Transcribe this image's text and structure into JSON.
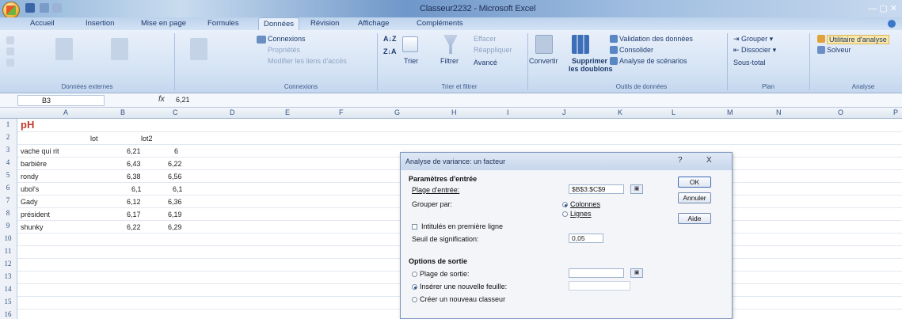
{
  "window": {
    "title": "Classeur2232 - Microsoft Excel"
  },
  "tabs": [
    "Accueil",
    "Insertion",
    "Mise en page",
    "Formules",
    "Données",
    "Révision",
    "Affichage",
    "Compléments"
  ],
  "active_tab": "Données",
  "ribbon": {
    "connexions": {
      "label": "Connexions",
      "props": "Propriétés",
      "edit_links": "Modifier les liens d'accès"
    },
    "tri": {
      "sort_asc": "A↓Z",
      "sort_desc": "Z↓A",
      "tri": "Trier",
      "filtre": "Filtrer",
      "avance": "Avancé",
      "effacer": "Effacer",
      "reappliquer": "Réappliquer",
      "group": "Trier et filtrer"
    },
    "outils": {
      "convertir": "Convertir",
      "supprimer": "Supprimer",
      "doublons": "les doublons",
      "validation": "Validation des données",
      "consolider": "Consolider",
      "analyse_scen": "Analyse de scénarios",
      "group": "Outils de données"
    },
    "plan": {
      "grouper": "Grouper",
      "dissocier": "Dissocier",
      "sous_total": "Sous-total",
      "group": "Plan"
    },
    "analyse": {
      "utilitaire": "Utilitaire d'analyse",
      "solveur": "Solveur",
      "group": "Analyse"
    },
    "donnees_ext": "Données externes"
  },
  "formula_bar": {
    "name_box": "B3",
    "fx": "fx",
    "content": "6,21"
  },
  "columns": [
    "A",
    "B",
    "C",
    "D",
    "E",
    "F",
    "G",
    "H",
    "I",
    "J",
    "K",
    "L",
    "M",
    "N",
    "O",
    "P"
  ],
  "rows": [
    "1",
    "2",
    "3",
    "4",
    "5",
    "6",
    "7",
    "8",
    "9",
    "10",
    "11",
    "12",
    "13",
    "14",
    "15",
    "16"
  ],
  "sheet": {
    "title": "pH",
    "headers": [
      "lot",
      "lot2"
    ],
    "data": [
      [
        "vache qui rit",
        "6,21",
        "6"
      ],
      [
        "barbière",
        "6,43",
        "6,22"
      ],
      [
        "rondy",
        "6,38",
        "6,56"
      ],
      [
        "ubol's",
        "6,1",
        "6,1"
      ],
      [
        "Gady",
        "6,12",
        "6,36"
      ],
      [
        "président",
        "6,17",
        "6,19"
      ],
      [
        "shunky",
        "6,22",
        "6,29"
      ]
    ]
  },
  "dialog": {
    "title": "Analyse de variance: un facteur",
    "input_section": "Paramètres d'entrée",
    "plage_entree_label": "Plage d'entrée:",
    "plage_entree_value": "$B$3:$C$9",
    "grouper_label": "Grouper par:",
    "opt_colonnes": "Colonnes",
    "opt_lignes": "Lignes",
    "intitule_label": "Intitulés en première ligne",
    "seuil_label": "Seuil de signification:",
    "seuil_value": "0,05",
    "output_section": "Options de sortie",
    "plage_sortie_label": "Plage de sortie:",
    "nouvelle_feuille_label": "Insérer une nouvelle feuille:",
    "nouveau_classeur_label": "Créer un nouveau classeur",
    "ok": "OK",
    "annuler": "Annuler",
    "aide": "Aide",
    "help_glyph": "?",
    "close_glyph": "X"
  }
}
